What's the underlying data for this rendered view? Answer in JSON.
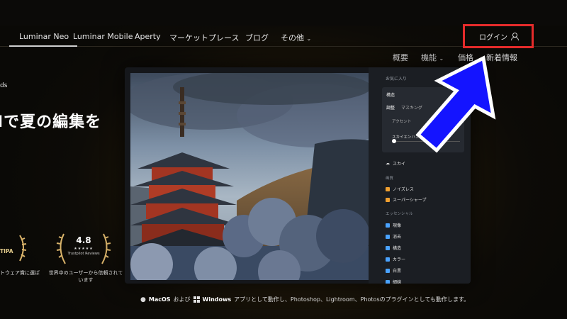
{
  "nav": {
    "items": [
      "Luminar Neo",
      "Luminar Mobile",
      "Aperty",
      "マーケットプレース",
      "ブログ",
      "その他"
    ],
    "login_label": "ログイン"
  },
  "subnav": {
    "items": [
      "概要",
      "機能",
      "価格",
      "新着情報"
    ]
  },
  "hero": {
    "side_small": "ds",
    "headline": "Iで夏の編集を"
  },
  "awards": {
    "tipa_text": "TIPA",
    "tipa_caption": "トウェア賞に選ば",
    "trust_rating": "4.8",
    "trust_stars": "★★★★★",
    "trust_label": "Trustpilot Reviews",
    "trust_caption": "世界中のユーザーから信頼されています"
  },
  "app": {
    "fav_label": "お気に入り",
    "card_title": "構造",
    "card_tab1": "調整",
    "card_tab2": "マスキング",
    "card_label1": "アクセント",
    "card_label2": "スカイエンハンサー",
    "sky_row": "スカイ",
    "section1": "画質",
    "noise_row": "ノイズレス",
    "sharp_row": "スーパーシャープ",
    "section2": "エッセンシャル",
    "rows": [
      "現像",
      "消去",
      "構造",
      "カラー",
      "白黒",
      "細線"
    ]
  },
  "footer": {
    "macos": "MacOS",
    "and": "および",
    "windows": "Windows",
    "rest": "アプリとして動作し、Photoshop、Lightroom、Photosのプラグインとしても動作します。"
  },
  "colors": {
    "highlight_box": "#e52b2b",
    "arrow_fill": "#1414ff",
    "arrow_stroke": "#ffffff",
    "accent_orange": "#f0a030"
  }
}
